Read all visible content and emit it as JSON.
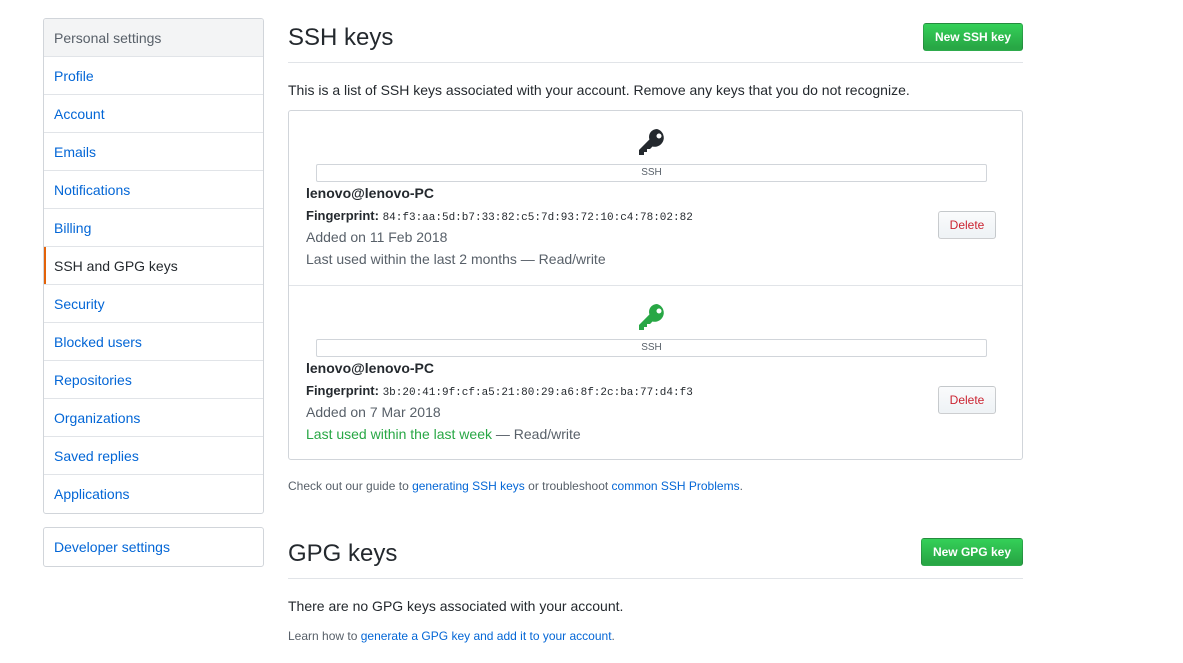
{
  "sidebar": {
    "heading": "Personal settings",
    "items": [
      {
        "label": "Profile"
      },
      {
        "label": "Account"
      },
      {
        "label": "Emails"
      },
      {
        "label": "Notifications"
      },
      {
        "label": "Billing"
      },
      {
        "label": "SSH and GPG keys",
        "selected": true
      },
      {
        "label": "Security"
      },
      {
        "label": "Blocked users"
      },
      {
        "label": "Repositories"
      },
      {
        "label": "Organizations"
      },
      {
        "label": "Saved replies"
      },
      {
        "label": "Applications"
      }
    ],
    "developer_settings": "Developer settings"
  },
  "ssh": {
    "title": "SSH keys",
    "new_button": "New SSH key",
    "description": "This is a list of SSH keys associated with your account. Remove any keys that you do not recognize.",
    "keys": [
      {
        "icon": "key-icon",
        "icon_color": "#24292e",
        "type": "SSH",
        "title": "lenovo@lenovo-PC",
        "fingerprint_label": "Fingerprint:",
        "fingerprint": "84:f3:aa:5d:b7:33:82:c5:7d:93:72:10:c4:78:02:82",
        "added": "Added on 11 Feb 2018",
        "last_used": "Last used within the last 2 months",
        "access": " — Read/write",
        "delete_label": "Delete"
      },
      {
        "icon": "key-icon",
        "icon_color": "#28a745",
        "type": "SSH",
        "title": "lenovo@lenovo-PC",
        "fingerprint_label": "Fingerprint:",
        "fingerprint": "3b:20:41:9f:cf:a5:21:80:29:a6:8f:2c:ba:77:d4:f3",
        "added": "Added on 7 Mar 2018",
        "last_used": "Last used within the last week",
        "access": " — Read/write",
        "delete_label": "Delete"
      }
    ],
    "guide": {
      "prefix": "Check out our guide to ",
      "link1": "generating SSH keys",
      "middle": " or troubleshoot ",
      "link2": "common SSH Problems",
      "suffix": "."
    }
  },
  "gpg": {
    "title": "GPG keys",
    "new_button": "New GPG key",
    "empty": "There are no GPG keys associated with your account.",
    "learn": {
      "prefix": "Learn how to ",
      "link": "generate a GPG key and add it to your account",
      "suffix": "."
    }
  }
}
